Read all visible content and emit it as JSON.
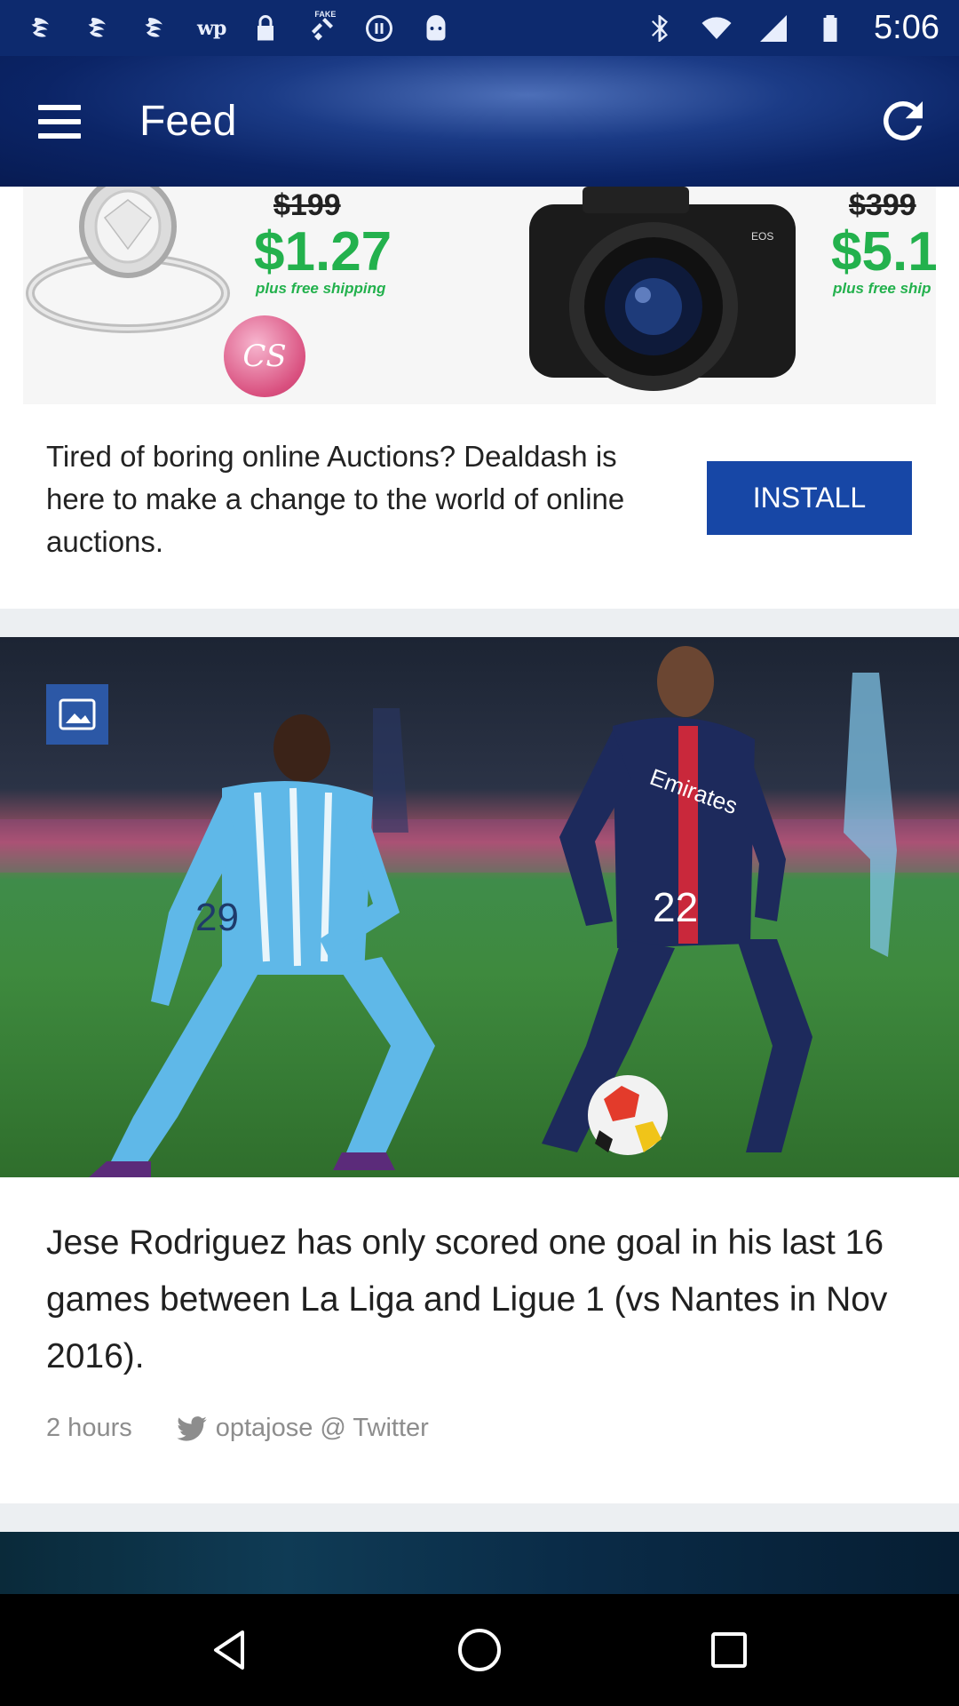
{
  "status_bar": {
    "left_icons": [
      "notification-icon",
      "notification-icon",
      "notification-icon",
      "wp-app-icon",
      "lock-icon",
      "fake-gps-icon",
      "pause-icon",
      "android-icon"
    ],
    "wp_text": "wp",
    "fake_text": "FAKE",
    "right_icons": [
      "bluetooth-icon",
      "wifi-icon",
      "signal-icon",
      "battery-icon"
    ],
    "time": "5:06"
  },
  "app_bar": {
    "title": "Feed",
    "menu_icon": "hamburger-menu-icon",
    "refresh_icon": "refresh-icon"
  },
  "ad": {
    "ring_old_price": "$199",
    "ring_new_price": "$1.27",
    "ring_sub": "plus free shipping",
    "logo_text": "CS",
    "camera_old_price": "$399",
    "camera_new_price": "$5.1",
    "camera_sub": "plus free ship",
    "description": "Tired of boring online Auctions? Dealdash is here to make a change to the world of online auctions.",
    "install_label": "INSTALL"
  },
  "news": {
    "image_badge_icon": "image-icon",
    "jersey_left": "29",
    "jersey_right": "22",
    "headline": "Jese Rodriguez has only scored one goal in his last 16 games between La Liga and Ligue 1 (vs Nantes in Nov 2016).",
    "time": "2 hours",
    "source": "optajose @ Twitter"
  },
  "nav_bar": {
    "back_icon": "back-triangle-icon",
    "home_icon": "home-circle-icon",
    "recents_icon": "recents-square-icon"
  },
  "colors": {
    "status_bar": "#0d2a6e",
    "accent": "#1747a6",
    "price_green": "#23b14d"
  }
}
